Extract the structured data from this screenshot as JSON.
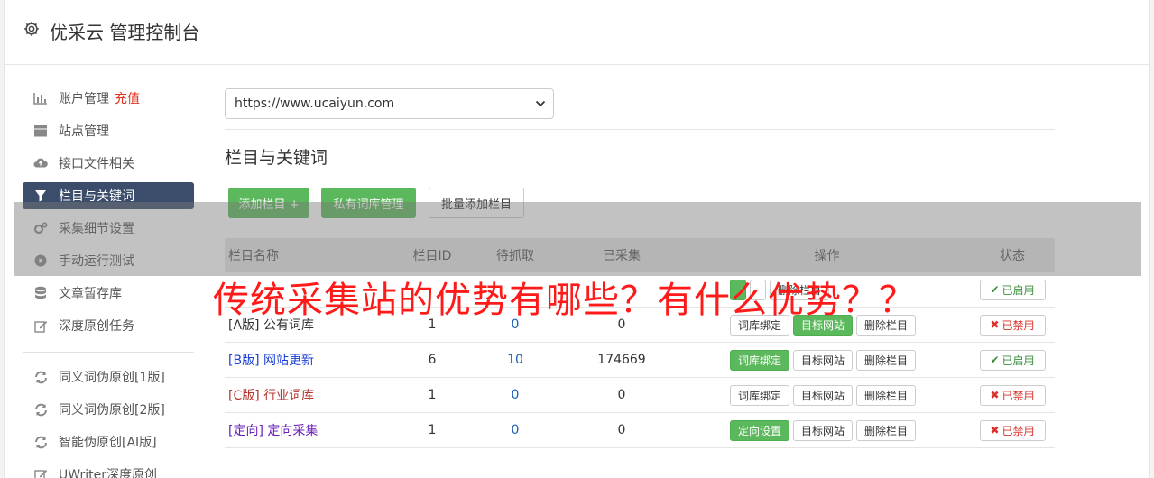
{
  "header": {
    "title": "优采云 管理控制台"
  },
  "sidebar": {
    "items": [
      {
        "label": "账户管理",
        "badge": "充值",
        "icon": "bar-chart-icon"
      },
      {
        "label": "站点管理",
        "icon": "server-icon"
      },
      {
        "label": "接口文件相关",
        "icon": "cloud-upload-icon"
      },
      {
        "label": "栏目与关键词",
        "icon": "filter-icon",
        "active": true
      },
      {
        "label": "采集细节设置",
        "icon": "gears-icon"
      },
      {
        "label": "手动运行测试",
        "icon": "play-icon"
      },
      {
        "label": "文章暂存库",
        "icon": "database-icon"
      },
      {
        "label": "深度原创任务",
        "icon": "edit-icon"
      },
      {
        "label": "同义词伪原创[1版]",
        "icon": "refresh-icon"
      },
      {
        "label": "同义词伪原创[2版]",
        "icon": "refresh-icon"
      },
      {
        "label": "智能伪原创[AI版]",
        "icon": "refresh-icon"
      },
      {
        "label": "UWriter深度原创",
        "icon": "edit-icon"
      }
    ]
  },
  "main": {
    "site_select": {
      "value": "https://www.ucaiyun.com"
    },
    "section_title": "栏目与关键词",
    "buttons": {
      "add_column": "添加栏目 +",
      "private_lib": "私有词库管理",
      "batch_add": "批量添加栏目"
    }
  },
  "table": {
    "headers": [
      "栏目名称",
      "栏目ID",
      "待抓取",
      "已采集",
      "操作",
      "状态"
    ],
    "rows": [
      {
        "prefix": "",
        "name": "",
        "id": "",
        "pending": "",
        "collected": "",
        "op1": "",
        "op1_green": true,
        "op2": "",
        "op2_green": false,
        "op3": "删除栏目",
        "status": "已启用",
        "enabled": true,
        "color": "#333"
      },
      {
        "prefix": "[A版]",
        "name": "公有词库",
        "id": "1",
        "pending": "0",
        "collected": "0",
        "op1": "词库绑定",
        "op1_green": false,
        "op2": "目标网站",
        "op2_green": true,
        "op3": "删除栏目",
        "status": "已禁用",
        "enabled": false,
        "color": "#333"
      },
      {
        "prefix": "[B版]",
        "name": "网站更新",
        "id": "6",
        "pending": "10",
        "collected": "174669",
        "op1": "词库绑定",
        "op1_green": true,
        "op2": "目标网站",
        "op2_green": false,
        "op3": "删除栏目",
        "status": "已启用",
        "enabled": true,
        "color": "#1a3fd6"
      },
      {
        "prefix": "[C版]",
        "name": "行业词库",
        "id": "1",
        "pending": "0",
        "collected": "0",
        "op1": "词库绑定",
        "op1_green": false,
        "op2": "目标网站",
        "op2_green": false,
        "op3": "删除栏目",
        "status": "已禁用",
        "enabled": false,
        "color": "#b5352f"
      },
      {
        "prefix": "[定向]",
        "name": "定向采集",
        "id": "1",
        "pending": "0",
        "collected": "0",
        "op1": "定向设置",
        "op1_green": true,
        "op2": "目标网站",
        "op2_green": false,
        "op3": "删除栏目",
        "status": "已禁用",
        "enabled": false,
        "color": "#6a1fb8"
      }
    ]
  },
  "overlay": {
    "text": "传统采集站的优势有哪些？有什么优势？？"
  },
  "colors": {
    "accent_green": "#5cb85c",
    "active_nav": "#3b4d6b",
    "danger": "#e0301e"
  }
}
